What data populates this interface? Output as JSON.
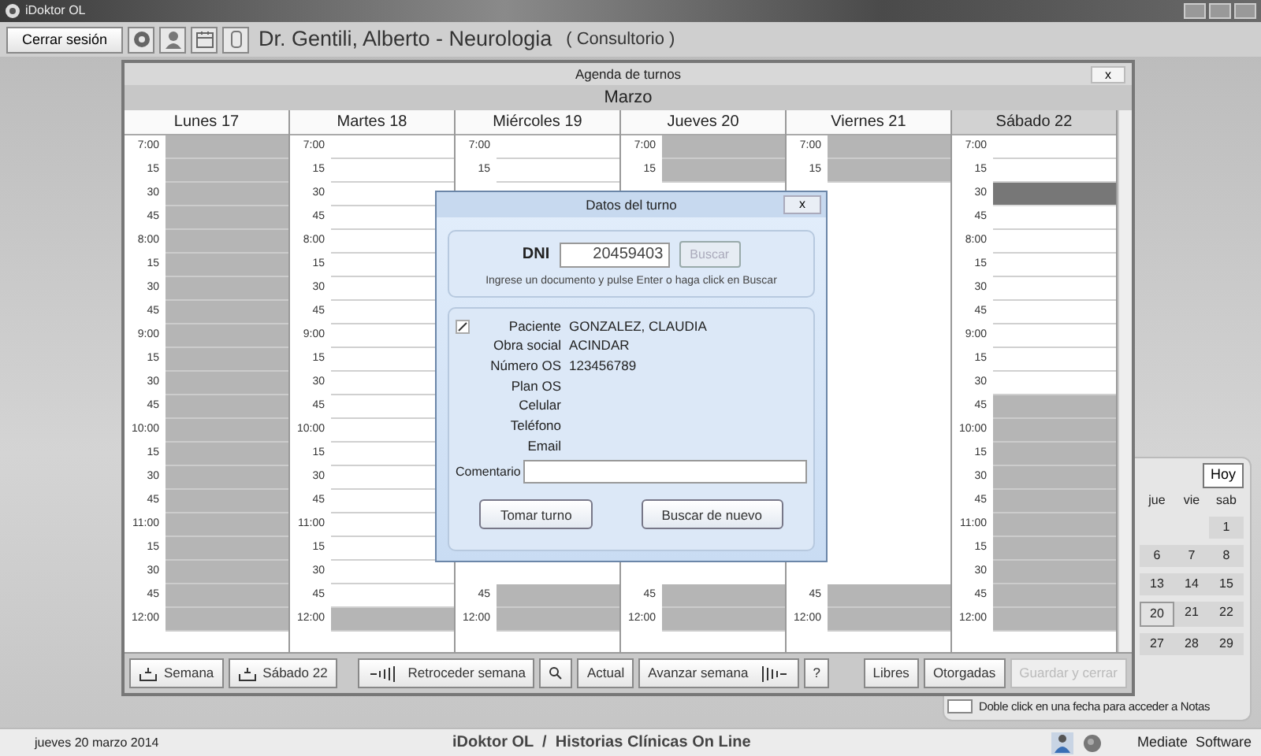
{
  "window": {
    "title": "iDoktor OL"
  },
  "toolbar": {
    "logout_button": "Cerrar sesión",
    "doctor": "Dr. Gentili, Alberto - Neurologia",
    "location": "( Consultorio )"
  },
  "agenda": {
    "title": "Agenda de turnos",
    "close": "x",
    "month": "Marzo",
    "days": [
      {
        "label": "Lunes 17",
        "selected": false,
        "slots": [
          {
            "time": "7:00",
            "kind": "blocked"
          },
          {
            "time": "15",
            "kind": "blocked"
          },
          {
            "time": "30",
            "kind": "blocked"
          },
          {
            "time": "45",
            "kind": "blocked"
          },
          {
            "time": "8:00",
            "kind": "blocked"
          },
          {
            "time": "15",
            "kind": "blocked"
          },
          {
            "time": "30",
            "kind": "blocked"
          },
          {
            "time": "45",
            "kind": "blocked"
          },
          {
            "time": "9:00",
            "kind": "blocked"
          },
          {
            "time": "15",
            "kind": "blocked"
          },
          {
            "time": "30",
            "kind": "blocked"
          },
          {
            "time": "45",
            "kind": "blocked"
          },
          {
            "time": "10:00",
            "kind": "blocked"
          },
          {
            "time": "15",
            "kind": "blocked"
          },
          {
            "time": "30",
            "kind": "blocked"
          },
          {
            "time": "45",
            "kind": "blocked"
          },
          {
            "time": "11:00",
            "kind": "blocked"
          },
          {
            "time": "15",
            "kind": "blocked"
          },
          {
            "time": "30",
            "kind": "blocked"
          },
          {
            "time": "45",
            "kind": "blocked"
          },
          {
            "time": "12:00",
            "kind": "blocked"
          }
        ]
      },
      {
        "label": "Martes 18",
        "selected": false,
        "slots": [
          {
            "time": "7:00",
            "kind": "free"
          },
          {
            "time": "15",
            "kind": "free"
          },
          {
            "time": "30",
            "kind": "free"
          },
          {
            "time": "45",
            "kind": "free"
          },
          {
            "time": "8:00",
            "kind": "free"
          },
          {
            "time": "15",
            "kind": "free"
          },
          {
            "time": "30",
            "kind": "free"
          },
          {
            "time": "45",
            "kind": "free"
          },
          {
            "time": "9:00",
            "kind": "free"
          },
          {
            "time": "15",
            "kind": "free"
          },
          {
            "time": "30",
            "kind": "free"
          },
          {
            "time": "45",
            "kind": "free"
          },
          {
            "time": "10:00",
            "kind": "free"
          },
          {
            "time": "15",
            "kind": "free"
          },
          {
            "time": "30",
            "kind": "free"
          },
          {
            "time": "45",
            "kind": "free"
          },
          {
            "time": "11:00",
            "kind": "free"
          },
          {
            "time": "15",
            "kind": "free"
          },
          {
            "time": "30",
            "kind": "free"
          },
          {
            "time": "45",
            "kind": "free"
          },
          {
            "time": "12:00",
            "kind": "blocked"
          }
        ]
      },
      {
        "label": "Miércoles 19",
        "selected": false,
        "slots": [
          {
            "time": "7:00",
            "kind": "free"
          },
          {
            "time": "15",
            "kind": "free"
          }
        ],
        "slots_bottom": [
          {
            "time": "45",
            "kind": "blocked"
          },
          {
            "time": "12:00",
            "kind": "blocked"
          }
        ]
      },
      {
        "label": "Jueves 20",
        "selected": false,
        "slots": [
          {
            "time": "7:00",
            "kind": "blocked"
          },
          {
            "time": "15",
            "kind": "blocked"
          }
        ],
        "slots_bottom": [
          {
            "time": "45",
            "kind": "blocked"
          },
          {
            "time": "12:00",
            "kind": "blocked"
          }
        ]
      },
      {
        "label": "Viernes 21",
        "selected": false,
        "slots": [
          {
            "time": "7:00",
            "kind": "blocked"
          },
          {
            "time": "15",
            "kind": "blocked"
          }
        ],
        "slots_bottom": [
          {
            "time": "45",
            "kind": "blocked"
          },
          {
            "time": "12:00",
            "kind": "blocked"
          }
        ]
      },
      {
        "label": "Sábado 22",
        "selected": true,
        "slots": [
          {
            "time": "7:00",
            "kind": "free"
          },
          {
            "time": "15",
            "kind": "free"
          },
          {
            "time": "30",
            "kind": "taken"
          },
          {
            "time": "45",
            "kind": "free"
          },
          {
            "time": "8:00",
            "kind": "free"
          },
          {
            "time": "15",
            "kind": "free"
          },
          {
            "time": "30",
            "kind": "free"
          },
          {
            "time": "45",
            "kind": "free"
          },
          {
            "time": "9:00",
            "kind": "free"
          },
          {
            "time": "15",
            "kind": "free"
          },
          {
            "time": "30",
            "kind": "free"
          },
          {
            "time": "45",
            "kind": "blocked"
          },
          {
            "time": "10:00",
            "kind": "blocked"
          },
          {
            "time": "15",
            "kind": "blocked"
          },
          {
            "time": "30",
            "kind": "blocked"
          },
          {
            "time": "45",
            "kind": "blocked"
          },
          {
            "time": "11:00",
            "kind": "blocked"
          },
          {
            "time": "15",
            "kind": "blocked"
          },
          {
            "time": "30",
            "kind": "blocked"
          },
          {
            "time": "45",
            "kind": "blocked"
          },
          {
            "time": "12:00",
            "kind": "blocked"
          }
        ]
      }
    ],
    "nav_buttons": [
      {
        "kind": "tray",
        "label": "Semana"
      },
      {
        "kind": "tray",
        "label": "Sábado 22"
      },
      {
        "kind": "back",
        "label": "Retroceder semana"
      },
      {
        "kind": "search"
      },
      {
        "kind": "plain",
        "label": "Actual"
      },
      {
        "kind": "forward",
        "label": "Avanzar semana"
      },
      {
        "kind": "help",
        "label": "?"
      }
    ],
    "action_buttons": [
      {
        "label": "Libres",
        "disabled": false
      },
      {
        "label": "Otorgadas",
        "disabled": false
      },
      {
        "label": "Guardar y cerrar",
        "disabled": true
      }
    ]
  },
  "dialog": {
    "title": "Datos del turno",
    "close": "x",
    "dni_label": "DNI",
    "dni_value": "20459403",
    "search_button": {
      "label": "Buscar",
      "disabled": true
    },
    "hint": "Ingrese un documento y pulse Enter o haga click en Buscar",
    "fields": [
      {
        "label": "Paciente",
        "value": "GONZALEZ, CLAUDIA"
      },
      {
        "label": "Obra social",
        "value": "ACINDAR"
      },
      {
        "label": "Número OS",
        "value": "123456789"
      },
      {
        "label": "Plan OS"
      },
      {
        "label": "Celular"
      },
      {
        "label": "Teléfono"
      },
      {
        "label": "Email"
      }
    ],
    "comment_label": "Comentario",
    "buttons": [
      "Tomar turno",
      "Buscar de nuevo"
    ]
  },
  "mini_calendar": {
    "today_button": "Hoy",
    "weekdays": [
      "jue",
      "vie",
      "sab"
    ],
    "weeks": [
      [
        {
          "day": "1",
          "selected": false
        }
      ],
      [
        {
          "day": "6",
          "selected": false
        },
        {
          "day": "7",
          "selected": false
        },
        {
          "day": "8",
          "selected": false
        }
      ],
      [
        {
          "day": "13",
          "selected": false
        },
        {
          "day": "14",
          "selected": false
        },
        {
          "day": "15",
          "selected": false
        }
      ],
      [
        {
          "day": "20",
          "selected": true
        },
        {
          "day": "21",
          "selected": false
        },
        {
          "day": "22",
          "selected": false
        }
      ],
      [
        {
          "day": "27",
          "selected": false
        },
        {
          "day": "28",
          "selected": false
        },
        {
          "day": "29",
          "selected": false
        }
      ]
    ],
    "note": "Doble click en una fecha para acceder a Notas"
  },
  "status_bar": {
    "date": "jueves 20 marzo 2014",
    "app": "iDoktor OL  /  Historias Clínicas On Line",
    "vendor": "Mediate  Software"
  }
}
